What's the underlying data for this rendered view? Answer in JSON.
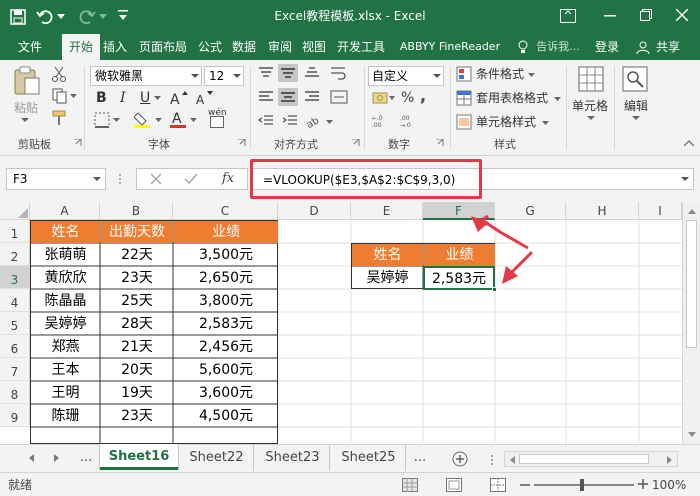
{
  "titlebar": {
    "title": "Excel教程模板.xlsx - Excel"
  },
  "tabs": [
    {
      "label": "文件"
    },
    {
      "label": "开始"
    },
    {
      "label": "插入"
    },
    {
      "label": "页面布局"
    },
    {
      "label": "公式"
    },
    {
      "label": "数据"
    },
    {
      "label": "审阅"
    },
    {
      "label": "视图"
    },
    {
      "label": "开发工具"
    },
    {
      "label": "ABBYY FineReader"
    },
    {
      "label": "告诉我..."
    },
    {
      "label": "登录"
    },
    {
      "label": "共享"
    }
  ],
  "ribbon": {
    "paste": "粘贴",
    "font_name": "微软雅黑",
    "font_size": "12",
    "bold": "B",
    "italic": "I",
    "underline": "U",
    "wen": "wén",
    "number_format": "自定义",
    "conditional": "条件格式",
    "table_format": "套用表格格式",
    "cell_style": "单元格样式",
    "cells": "单元格",
    "edit": "编辑",
    "groups": {
      "clipboard": "剪贴板",
      "font": "字体",
      "align": "对齐方式",
      "number": "数字",
      "styles": "样式"
    }
  },
  "formula": {
    "namebox": "F3",
    "fx": "fx",
    "value": "=VLOOKUP($E3,$A$2:$C$9,3,0)"
  },
  "grid": {
    "columns": [
      "A",
      "B",
      "C",
      "D",
      "E",
      "F",
      "G",
      "H",
      "I"
    ],
    "rows": [
      "1",
      "2",
      "3",
      "4",
      "5",
      "6",
      "7",
      "8",
      "9"
    ],
    "table_headers": [
      "姓名",
      "出勤天数",
      "业绩"
    ],
    "table_rows": [
      [
        "张萌萌",
        "22天",
        "3,500元"
      ],
      [
        "黄欣欣",
        "23天",
        "2,650元"
      ],
      [
        "陈晶晶",
        "25天",
        "3,800元"
      ],
      [
        "吴婷婷",
        "28天",
        "2,583元"
      ],
      [
        "郑燕",
        "21天",
        "2,456元"
      ],
      [
        "王本",
        "20天",
        "5,600元"
      ],
      [
        "王明",
        "19天",
        "3,600元"
      ],
      [
        "陈珊",
        "23天",
        "4,500元"
      ]
    ],
    "lookup_headers": [
      "姓名",
      "业绩"
    ],
    "lookup_row": [
      "吴婷婷",
      "2,583元"
    ]
  },
  "sheets": [
    "...",
    "Sheet16",
    "Sheet22",
    "Sheet23",
    "Sheet25",
    "..."
  ],
  "status": {
    "ready": "就绪",
    "zoom": "100%"
  },
  "colors": {
    "accent": "#217346",
    "header": "#ed7d31",
    "highlight": "#e63946"
  }
}
